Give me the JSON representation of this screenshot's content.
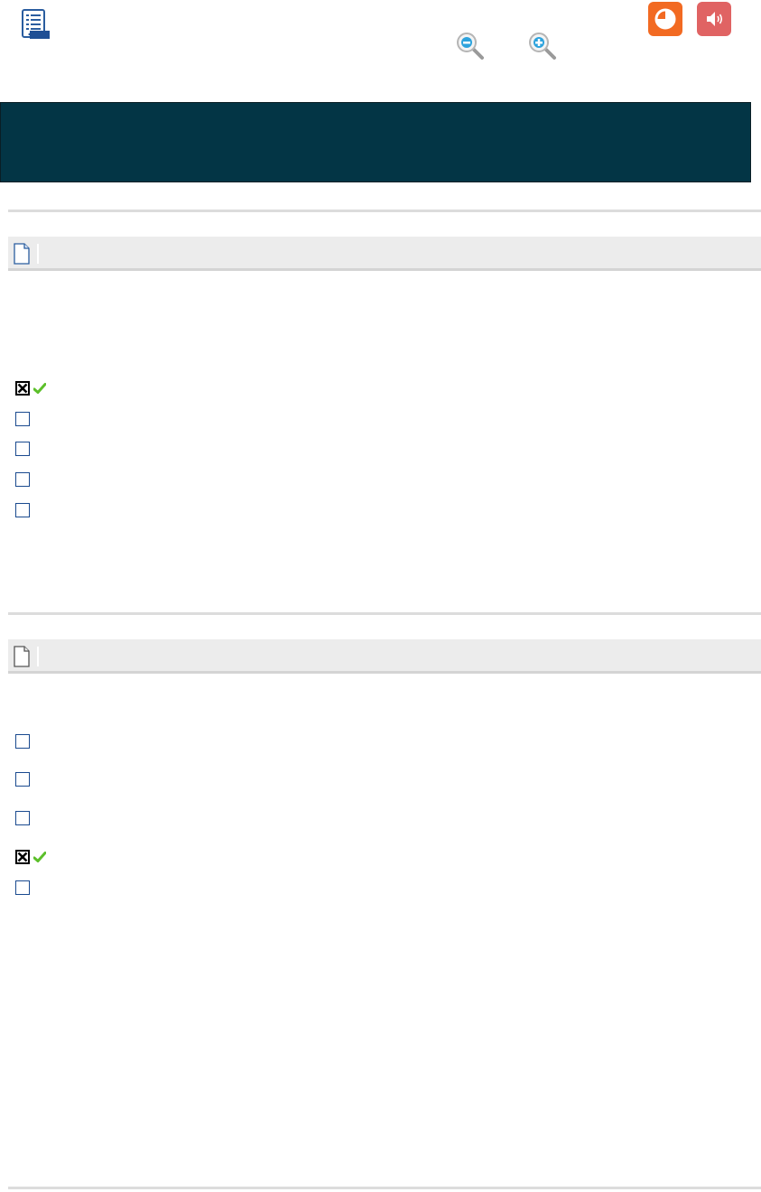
{
  "toolbar": {
    "toc_icon": "table-of-contents-icon",
    "zoom_out_icon": "zoom-out-icon",
    "zoom_in_icon": "zoom-in-icon",
    "chart_icon": "pie-chart-icon",
    "audio_icon": "speaker-icon",
    "chart_color": "#f26a22",
    "audio_color": "#e06363"
  },
  "banner": {
    "title": "",
    "background": "#033545"
  },
  "question1": {
    "icon": "page-icon",
    "options": [
      {
        "checked": true,
        "correct": true,
        "label": ""
      },
      {
        "checked": false,
        "correct": false,
        "label": ""
      },
      {
        "checked": false,
        "correct": false,
        "label": ""
      },
      {
        "checked": false,
        "correct": false,
        "label": ""
      },
      {
        "checked": false,
        "correct": false,
        "label": ""
      }
    ]
  },
  "question2": {
    "icon": "page-icon",
    "options": [
      {
        "checked": false,
        "correct": false,
        "label": ""
      },
      {
        "checked": false,
        "correct": false,
        "label": ""
      },
      {
        "checked": false,
        "correct": false,
        "label": ""
      },
      {
        "checked": true,
        "correct": true,
        "label": ""
      },
      {
        "checked": false,
        "correct": false,
        "label": ""
      }
    ]
  }
}
